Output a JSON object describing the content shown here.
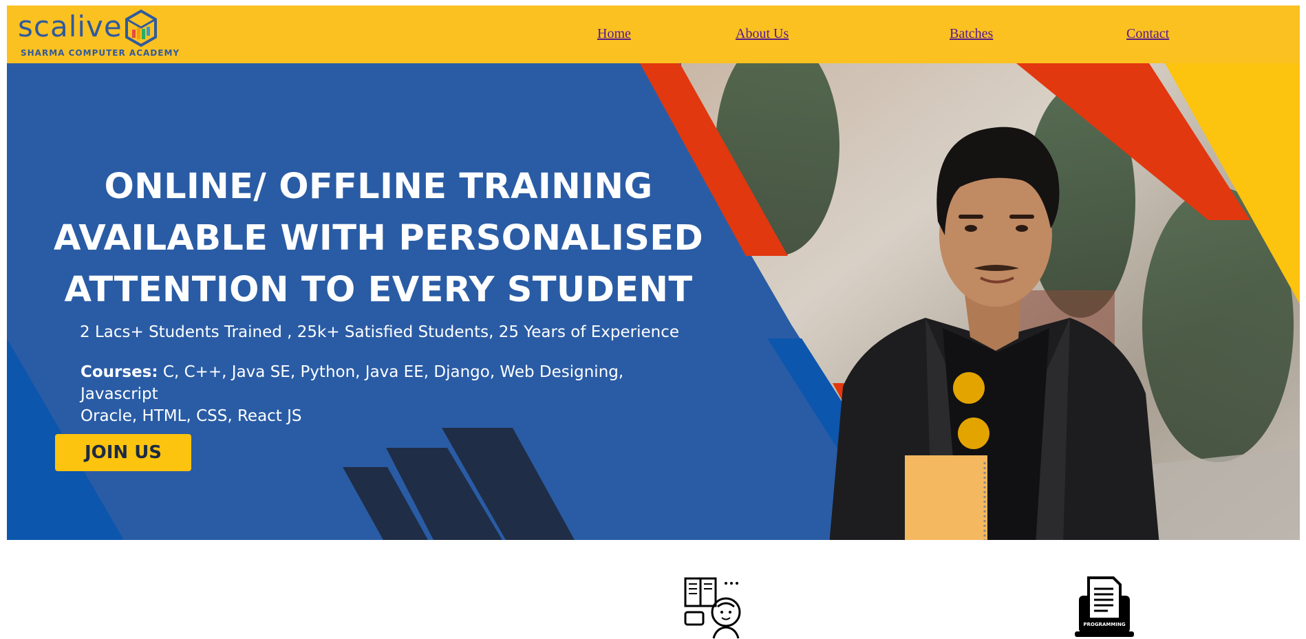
{
  "brand": {
    "name": "scalive",
    "subtitle": "SHARMA COMPUTER ACADEMY"
  },
  "nav": {
    "links": [
      "Home",
      "About Us",
      "Batches",
      "Contact"
    ]
  },
  "hero": {
    "title_lines": [
      "ONLINE/ OFFLINE TRAINING",
      "AVAILABLE WITH PERSONALISED",
      "ATTENTION TO EVERY STUDENT"
    ],
    "stats": "2 Lacs+ Students Trained , 25k+ Satisfied Students, 25 Years of Experience",
    "courses_label": "Courses:",
    "courses_line1": " C, C++, Java SE, Python, Java EE, Django, Web Designing, Javascript",
    "courses_line2": "Oracle, HTML, CSS, React JS",
    "cta": "JOIN US"
  },
  "features": {
    "icons": [
      "learning-mind-icon",
      "programming-laptop-icon"
    ],
    "programming_icon_label": "PROGRAMMING"
  },
  "colors": {
    "navbar": "#fbc121",
    "hero_blue": "#2a5ca5",
    "accent_red": "#e2380f",
    "accent_yellow": "#fcc30f",
    "dark_navy": "#1f2d47"
  }
}
